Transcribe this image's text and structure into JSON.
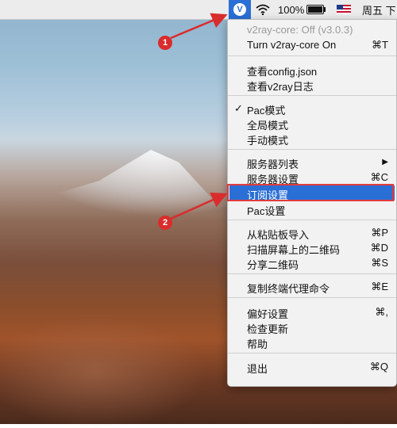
{
  "menubar": {
    "v2ray_icon": "v2ray-icon",
    "wifi_icon": "wifi-icon",
    "battery_percent": "100%",
    "battery_level": 1.0,
    "input_flag": "us-flag-icon",
    "clock": "周五 下"
  },
  "menu": {
    "status": "v2ray-core: Off  (v3.0.3)",
    "toggle": {
      "label": "Turn v2ray-core On",
      "shortcut": "⌘T"
    },
    "view_config": "查看config.json",
    "view_log": "查看v2ray日志",
    "pac_mode": {
      "check": "✓",
      "label": "Pac模式"
    },
    "global_mode": "全局模式",
    "manual_mode": "手动模式",
    "server_list": {
      "label": "服务器列表",
      "submenu_arrow": "▶"
    },
    "server_settings": {
      "label": "服务器设置",
      "shortcut": "⌘C"
    },
    "subscribe_settings": "订阅设置",
    "pac_settings": "Pac设置",
    "import_clipboard": {
      "label": "从粘贴板导入",
      "shortcut": "⌘P"
    },
    "scan_qr": {
      "label": "扫描屏幕上的二维码",
      "shortcut": "⌘D"
    },
    "share_qr": {
      "label": "分享二维码",
      "shortcut": "⌘S"
    },
    "copy_terminal_proxy": {
      "label": "复制终端代理命令",
      "shortcut": "⌘E"
    },
    "preferences": {
      "label": "偏好设置",
      "shortcut": "⌘,"
    },
    "check_update": "检查更新",
    "help": "帮助",
    "quit": {
      "label": "退出",
      "shortcut": "⌘Q"
    }
  },
  "annotations": {
    "badge1": "1",
    "badge2": "2",
    "accent_color": "#d92c2c",
    "highlight_color": "#2a6fd6"
  }
}
